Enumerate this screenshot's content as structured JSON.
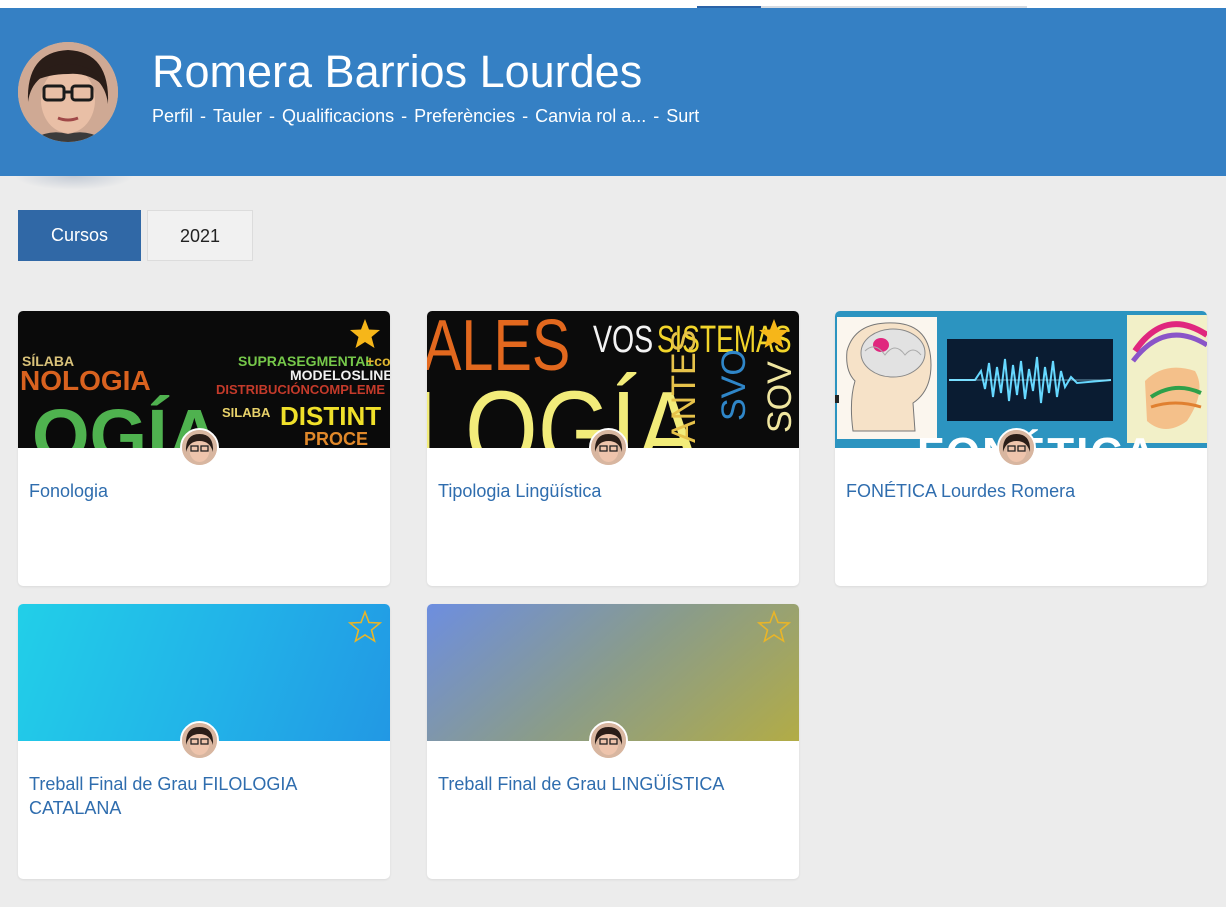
{
  "header": {
    "user_name": "Romera Barrios Lourdes",
    "nav": {
      "perfil": "Perfil",
      "tauler": "Tauler",
      "qualificacions": "Qualificacions",
      "preferencies": "Preferències",
      "canvia_rol": "Canvia rol a...",
      "surt": "Surt",
      "separator": "-"
    }
  },
  "tabs": {
    "cursos": "Cursos",
    "year": "2021"
  },
  "courses": [
    {
      "title": "Fonologia",
      "starred": true,
      "banner_words": [
        "SÍLABA",
        "NOLOGIA",
        "OGÍA",
        "SUPRASEGMENTAL",
        "+co",
        "MODELOSLINEA",
        "DISTRIBUCIÓNCOMPLEME",
        "SILABA",
        "DISTINT",
        "PROCE"
      ]
    },
    {
      "title": "Tipologia Lingüística",
      "starred": true,
      "banner_words": [
        "ALES",
        "VOS",
        "SISTEMAS",
        "LOGÍA",
        "ANTES",
        "SVO",
        "SOV"
      ]
    },
    {
      "title": "FONÉTICA Lourdes Romera",
      "starred": false,
      "banner_words": [
        "FONÉTICA"
      ]
    },
    {
      "title": "Treball Final de Grau FILOLOGIA CATALANA",
      "starred": false
    },
    {
      "title": "Treball Final de Grau LINGÜÍSTICA",
      "starred": false
    }
  ],
  "colors": {
    "header_bg": "#3580c4",
    "tab_active": "#3068a6",
    "course_link": "#2f6dae",
    "star_filled": "#f6b619",
    "star_outline": "#e9b528"
  },
  "icons": {
    "star_filled": "star-filled-icon",
    "star_empty": "star-outline-icon"
  }
}
